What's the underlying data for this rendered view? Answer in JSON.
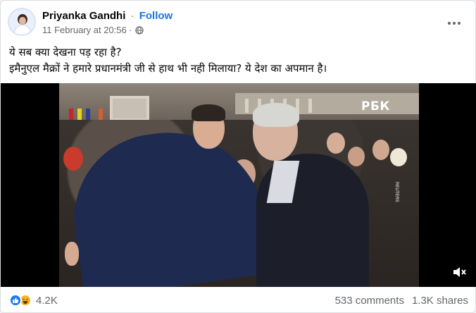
{
  "post": {
    "author": "Priyanka Gandhi",
    "separator": "·",
    "follow_label": "Follow",
    "timestamp": "11 February at 20:56",
    "timestamp_separator": "·",
    "privacy_icon": "globe-icon",
    "more_icon": "more-options-icon",
    "text_lines": [
      "ये सब क्या देखना पड़ रहा है?",
      "इमैनुएल मैक्रों ने हमारे प्रधानमंत्री जी से हाथ भी नही मिलाया? ये देश का अपमान है।"
    ]
  },
  "video": {
    "watermark": "РБК",
    "credit": "REUTERS",
    "mute_icon": "volume-muted-icon"
  },
  "footer": {
    "reaction_icons": [
      "like-reaction-icon",
      "haha-reaction-icon"
    ],
    "reaction_count": "4.2K",
    "comments": "533 comments",
    "shares": "1.3K shares"
  },
  "colors": {
    "accent": "#1b74e4",
    "secondary_text": "#65676b",
    "like": "#1877f2",
    "haha": "#f7b125"
  }
}
